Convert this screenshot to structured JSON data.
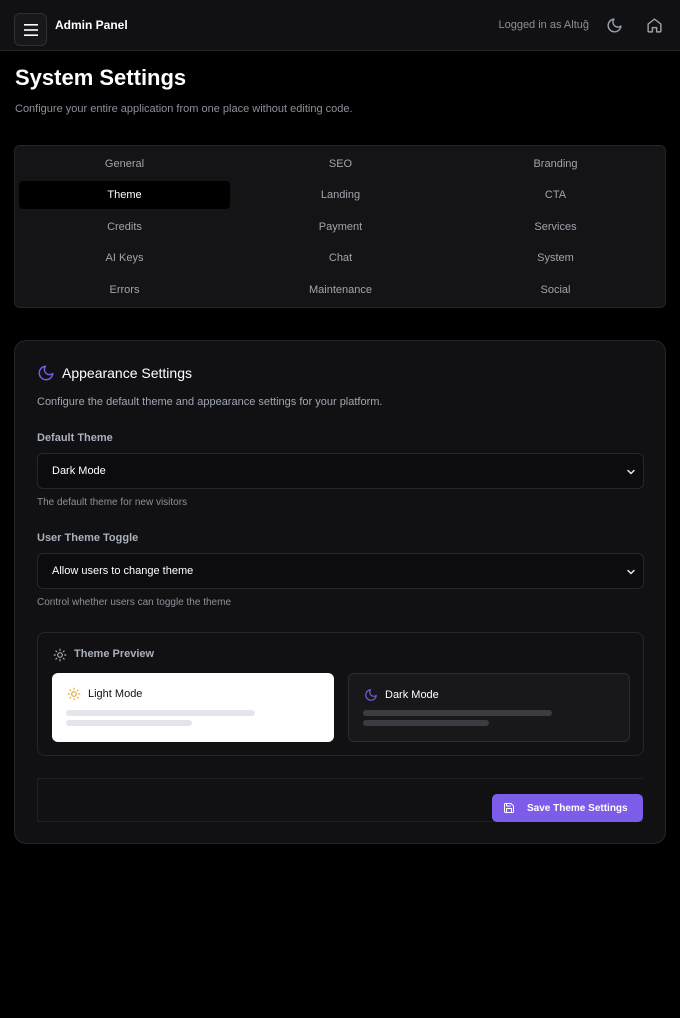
{
  "header": {
    "title": "Admin Panel",
    "logged_in": "Logged in as Altuğ",
    "icons": [
      "menu-icon",
      "moon-icon",
      "home-icon"
    ]
  },
  "page": {
    "title": "System Settings",
    "subtitle": "Configure your entire application from one place without editing code."
  },
  "tabs": [
    {
      "label": "General"
    },
    {
      "label": "SEO"
    },
    {
      "label": "Branding"
    },
    {
      "label": "Theme",
      "active": true
    },
    {
      "label": "Landing"
    },
    {
      "label": "CTA"
    },
    {
      "label": "Credits"
    },
    {
      "label": "Payment"
    },
    {
      "label": "Services"
    },
    {
      "label": "AI Keys"
    },
    {
      "label": "Chat"
    },
    {
      "label": "System"
    },
    {
      "label": "Errors"
    },
    {
      "label": "Maintenance"
    },
    {
      "label": "Social"
    }
  ],
  "appearance": {
    "title": "Appearance Settings",
    "description": "Configure the default theme and appearance settings for your platform.",
    "default_theme": {
      "label": "Default Theme",
      "value": "Dark Mode",
      "hint": "The default theme for new visitors"
    },
    "user_toggle": {
      "label": "User Theme Toggle",
      "value": "Allow users to change theme",
      "hint": "Control whether users can toggle the theme"
    },
    "preview": {
      "title": "Theme Preview",
      "light_label": "Light Mode",
      "dark_label": "Dark Mode"
    },
    "save_label": "Save Theme Settings"
  },
  "colors": {
    "accent": "#7c5ce8",
    "moon_icon": "#6d5fe3",
    "sun_icon": "#e0a82e"
  }
}
